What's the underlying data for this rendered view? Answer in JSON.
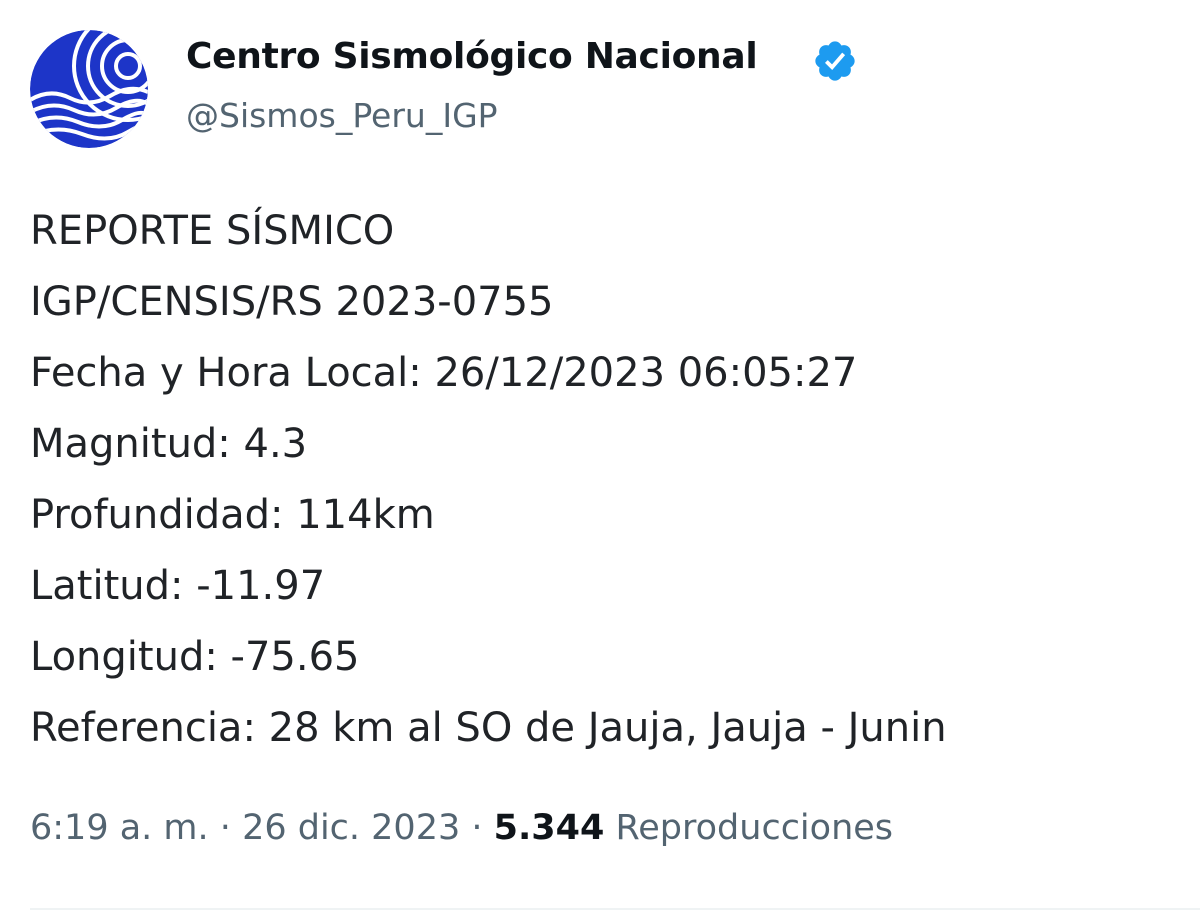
{
  "author": {
    "display_name": "Centro Sismológico Nacional",
    "handle": "@Sismos_Peru_IGP",
    "verified": true,
    "avatar_icon": "concentric-waves-logo"
  },
  "tweet": {
    "lines": [
      "REPORTE SÍSMICO",
      "IGP/CENSIS/RS 2023-0755",
      "Fecha y Hora Local: 26/12/2023 06:05:27",
      "Magnitud: 4.3",
      "Profundidad: 114km",
      "Latitud: -11.97",
      "Longitud: -75.65",
      "Referencia: 28 km al SO de Jauja, Jauja - Junin"
    ]
  },
  "meta": {
    "time": "6:19 a. m.",
    "separator": "·",
    "date": "26 dic. 2023",
    "views_count": "5.344",
    "views_label": "Reproducciones"
  },
  "colors": {
    "brand_blue": "#1d35c8",
    "verified_blue": "#1d9bf0",
    "secondary_text": "#536471",
    "primary_text": "#0f1419"
  }
}
